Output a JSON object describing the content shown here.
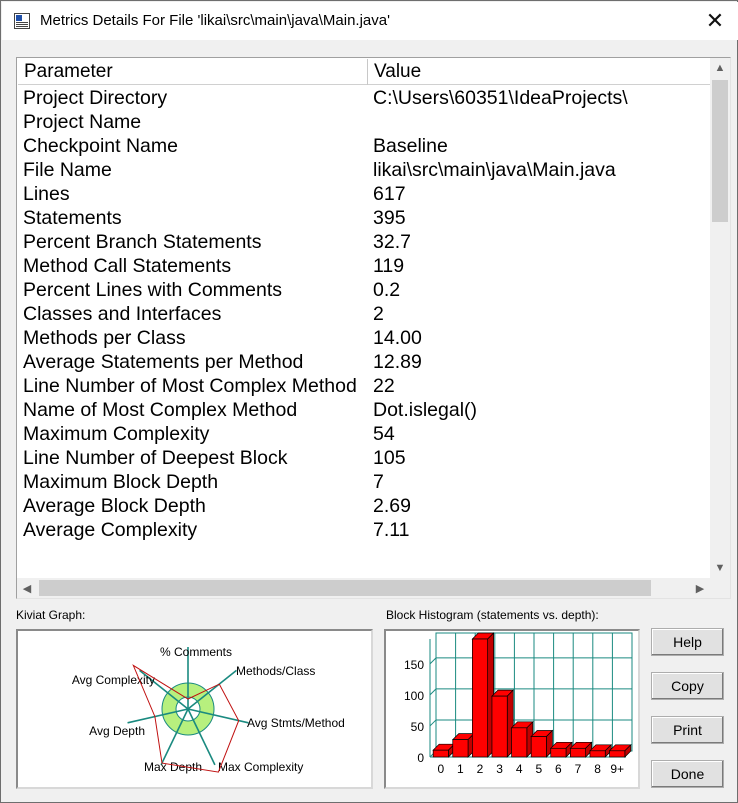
{
  "window": {
    "title": "Metrics Details For File 'likai\\src\\main\\java\\Main.java'",
    "close_glyph": "✕"
  },
  "table": {
    "headers": {
      "parameter": "Parameter",
      "value": "Value"
    },
    "rows": [
      {
        "parameter": "Project Directory",
        "value": "C:\\Users\\60351\\IdeaProjects\\"
      },
      {
        "parameter": "Project Name",
        "value": ""
      },
      {
        "parameter": "Checkpoint Name",
        "value": "Baseline"
      },
      {
        "parameter": "File Name",
        "value": "likai\\src\\main\\java\\Main.java"
      },
      {
        "parameter": "Lines",
        "value": "617"
      },
      {
        "parameter": "Statements",
        "value": "395"
      },
      {
        "parameter": "Percent Branch Statements",
        "value": "32.7"
      },
      {
        "parameter": "Method Call Statements",
        "value": "119"
      },
      {
        "parameter": "Percent Lines with Comments",
        "value": "0.2"
      },
      {
        "parameter": "Classes and Interfaces",
        "value": "2"
      },
      {
        "parameter": "Methods per Class",
        "value": "14.00"
      },
      {
        "parameter": "Average Statements per Method",
        "value": "12.89"
      },
      {
        "parameter": "Line Number of Most Complex Method",
        "value": "22"
      },
      {
        "parameter": "Name of Most Complex Method",
        "value": "Dot.islegal()"
      },
      {
        "parameter": "Maximum Complexity",
        "value": "54"
      },
      {
        "parameter": "Line Number of Deepest Block",
        "value": "105"
      },
      {
        "parameter": "Maximum Block Depth",
        "value": "7"
      },
      {
        "parameter": "Average Block Depth",
        "value": "2.69"
      },
      {
        "parameter": "Average Complexity",
        "value": "7.11"
      }
    ]
  },
  "kiviat": {
    "label": "Kiviat Graph:",
    "axes": [
      "% Comments",
      "Methods/Class",
      "Avg Stmts/Method",
      "Max Complexity",
      "Max Depth",
      "Avg Depth",
      "Avg Complexity"
    ],
    "colors": {
      "inner_ring": "#ffffff",
      "ring": "#b7f07e",
      "axis": "#1a8a80",
      "outline": "#c01010",
      "ring_border": "#1a8a80"
    }
  },
  "histogram": {
    "label": "Block Histogram (statements vs. depth):",
    "chart_data": {
      "type": "bar",
      "categories": [
        "0",
        "1",
        "2",
        "3",
        "4",
        "5",
        "6",
        "7",
        "8",
        "9+"
      ],
      "values": [
        11,
        28,
        192,
        98,
        47,
        33,
        14,
        14,
        10,
        10
      ],
      "yticks": [
        "0",
        "50",
        "100",
        "150"
      ],
      "ylim": [
        0,
        190
      ],
      "grid": true,
      "bar_color": "#ff0000",
      "grid_color": "#1a8a80"
    }
  },
  "buttons": {
    "help": "Help",
    "copy": "Copy",
    "print": "Print",
    "done": "Done"
  },
  "scrollbar_glyphs": {
    "up": "▲",
    "down": "▼",
    "left": "◀",
    "right": "▶"
  }
}
